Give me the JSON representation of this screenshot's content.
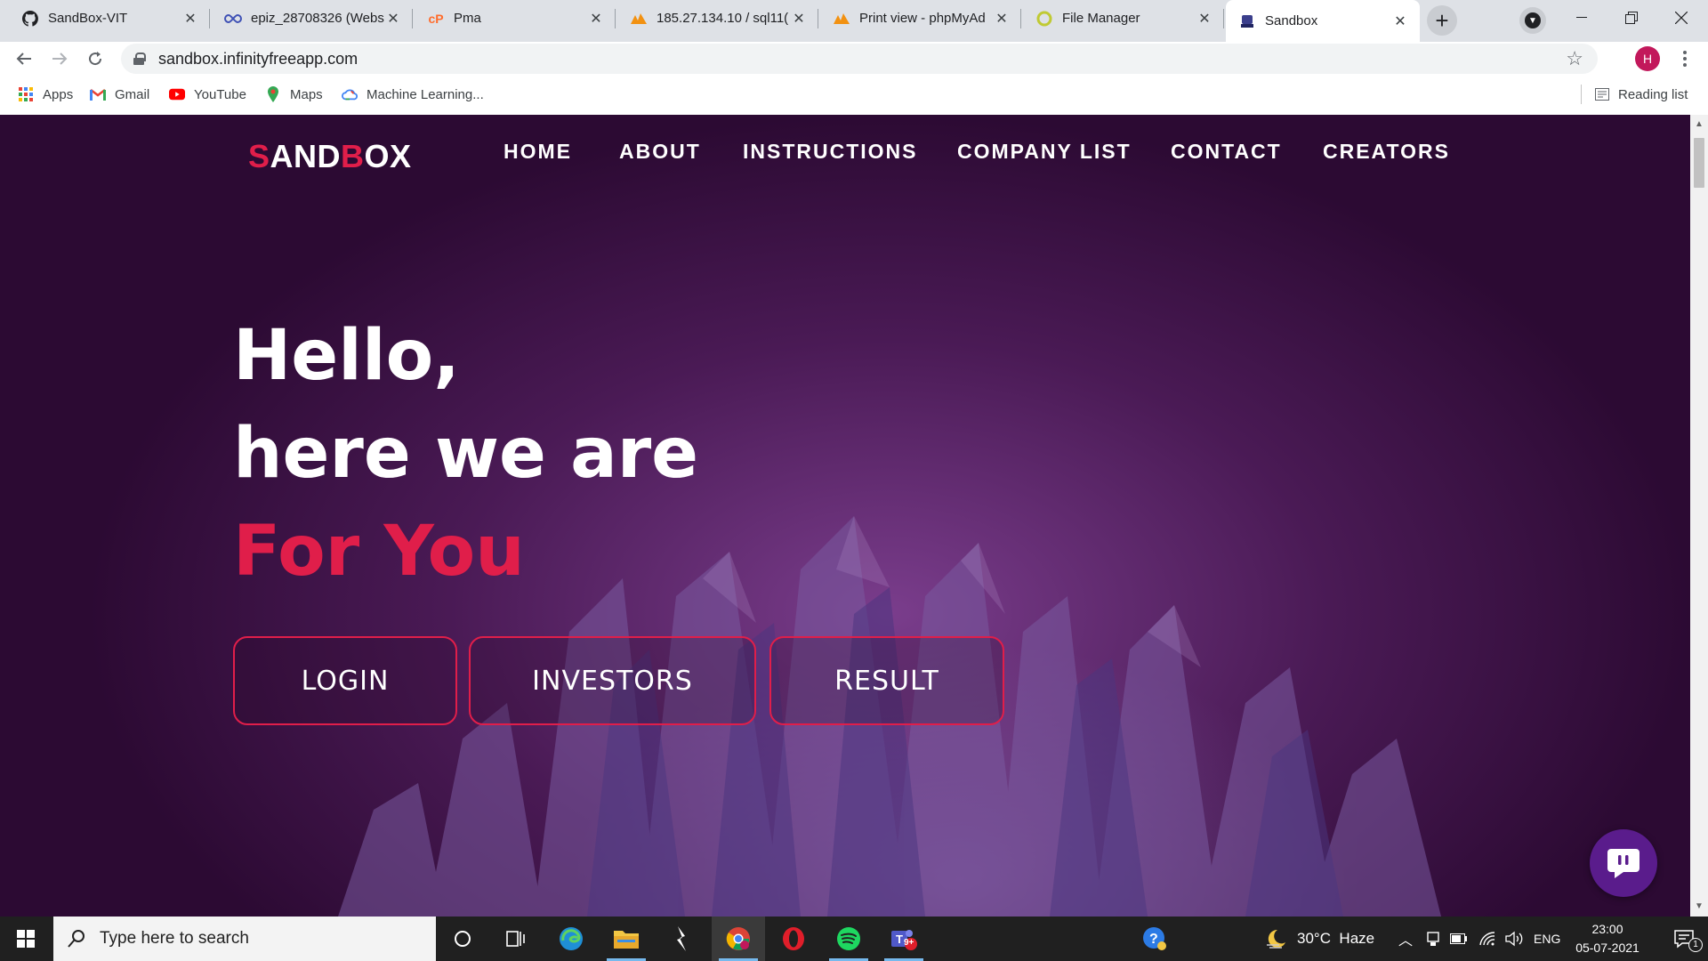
{
  "browser": {
    "tabs": [
      {
        "title": "SandBox-VIT",
        "icon": "github-icon"
      },
      {
        "title": "epiz_28708326 (Webs",
        "icon": "infinity-icon"
      },
      {
        "title": "Pma",
        "icon": "cpanel-icon"
      },
      {
        "title": "185.27.134.10 / sql11(",
        "icon": "phpmyadmin-icon"
      },
      {
        "title": "Print view - phpMyAd",
        "icon": "phpmyadmin-icon"
      },
      {
        "title": "File Manager",
        "icon": "file-manager-icon"
      },
      {
        "title": "Sandbox",
        "icon": "sandbox-favicon",
        "active": true
      }
    ],
    "url": "sandbox.infinityfreeapp.com",
    "profile_initial": "H",
    "bookmarks": [
      {
        "label": "Apps",
        "icon": "apps-grid-icon"
      },
      {
        "label": "Gmail",
        "icon": "gmail-icon"
      },
      {
        "label": "YouTube",
        "icon": "youtube-icon"
      },
      {
        "label": "Maps",
        "icon": "maps-icon"
      },
      {
        "label": "Machine Learning...",
        "icon": "google-cloud-icon"
      }
    ],
    "reading_list": "Reading list"
  },
  "site": {
    "brand_first": "S",
    "brand_mid": "AND",
    "brand_b": "B",
    "brand_rest": "OX",
    "nav": [
      "HOME",
      "ABOUT",
      "INSTRUCTIONS",
      "COMPANY LIST",
      "CONTACT",
      "CREATORS"
    ],
    "hero_line1": "Hello,",
    "hero_line2": "here we are",
    "hero_line3": "For You",
    "buttons": [
      "LOGIN",
      "INVESTORS",
      "RESULT"
    ],
    "accent_color": "#e01e4a",
    "background_color": "#3a1040"
  },
  "taskbar": {
    "search_placeholder": "Type here to search",
    "weather": "30°C  Haze",
    "language": "ENG",
    "time": "23:00",
    "date": "05-07-2021",
    "teams_badge": "9+",
    "notification_count": "1"
  }
}
